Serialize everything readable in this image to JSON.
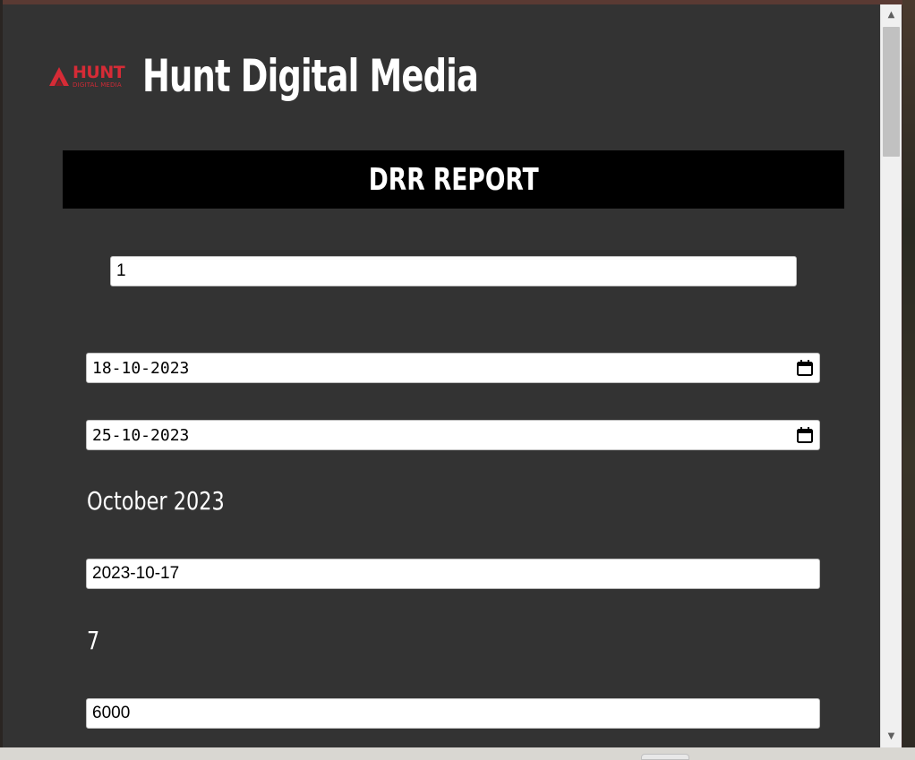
{
  "brand": {
    "logo_word": "HUNT",
    "logo_sub": "DIGITAL MEDIA",
    "title": "Hunt Digital Media",
    "accent_color": "#d62b36"
  },
  "report": {
    "title": "DRR REPORT"
  },
  "form": {
    "id_value": "1",
    "start_date": "18-10-2023",
    "end_date": "25-10-2023",
    "month_label": "October 2023",
    "ref_date": "2023-10-17",
    "days_count": "7",
    "amount": "6000"
  },
  "icons": {
    "calendar": "calendar-icon",
    "scroll_up": "chevron-up-icon",
    "scroll_down": "chevron-down-icon"
  },
  "colors": {
    "panel_bg": "#333333",
    "banner_bg": "#000000",
    "field_bg": "#ffffff"
  }
}
